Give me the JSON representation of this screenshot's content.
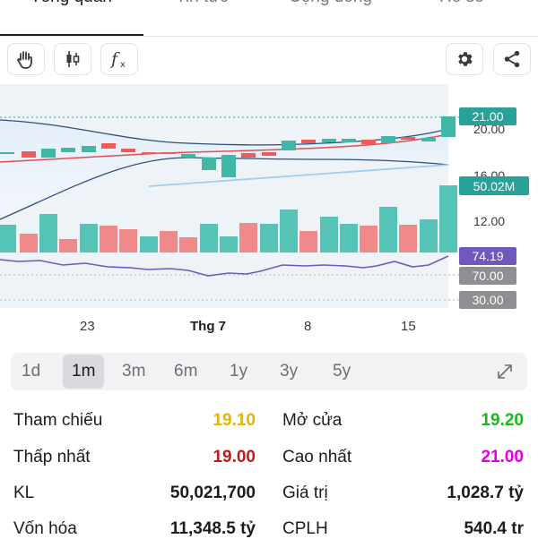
{
  "tabs": [
    {
      "label": "Tổng quan",
      "active": true
    },
    {
      "label": "Tin tức",
      "active": false
    },
    {
      "label": "Cộng đồng",
      "active": false
    },
    {
      "label": "Hồ sơ",
      "active": false
    }
  ],
  "toolbar": {
    "icons": [
      "hand-draw-icon",
      "candlestick-icon",
      "function-icon",
      "gear-icon",
      "share-icon"
    ]
  },
  "price_axis": {
    "labels": [
      "20.00",
      "16.00",
      "12.00"
    ],
    "last_price": "21.00",
    "volume_badge": "50.02M",
    "rsi_value": "74.19",
    "rsi_upper": "70.00",
    "rsi_lower": "30.00"
  },
  "date_labels": {
    "d1": "23",
    "d2": "Thg 7",
    "d3": "8",
    "d4": "15"
  },
  "ranges": [
    {
      "label": "1d",
      "active": false
    },
    {
      "label": "1m",
      "active": true
    },
    {
      "label": "3m",
      "active": false
    },
    {
      "label": "6m",
      "active": false
    },
    {
      "label": "1y",
      "active": false
    },
    {
      "label": "3y",
      "active": false
    },
    {
      "label": "5y",
      "active": false
    }
  ],
  "stats": {
    "reference_label": "Tham chiếu",
    "reference_value": "19.10",
    "open_label": "Mở cửa",
    "open_value": "19.20",
    "low_label": "Thấp nhất",
    "low_value": "19.00",
    "high_label": "Cao nhất",
    "high_value": "21.00",
    "volume_label": "KL",
    "volume_value": "50,021,700",
    "value_label": "Giá trị",
    "value_value": "1,028.7 tỷ",
    "cap_label": "Vốn hóa",
    "cap_value": "11,348.5 tỷ",
    "shares_label": "CPLH",
    "shares_value": "540.4 tr"
  },
  "colors": {
    "up": "#3fb8a8",
    "down": "#ef5a5a",
    "reference": "#e6b400",
    "open": "#19b81c",
    "low": "#c21a1a",
    "high": "#e100e1",
    "rsi": "#7058be"
  }
}
